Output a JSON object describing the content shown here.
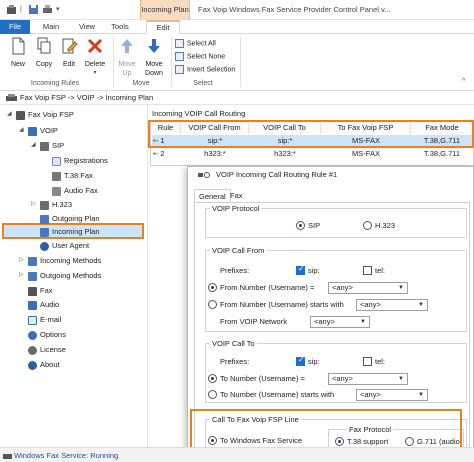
{
  "window": {
    "title": "Fax Voip Windows Fax Service Provider Control Panel v...",
    "context_tab_header": "Incoming Plan"
  },
  "tabs": [
    {
      "label": "File"
    },
    {
      "label": "Main"
    },
    {
      "label": "View"
    },
    {
      "label": "Tools"
    },
    {
      "label": "Edit"
    }
  ],
  "ribbon": {
    "new": "New",
    "copy": "Copy",
    "edit": "Edit",
    "delete": "Delete",
    "move_up": "Move Up",
    "move_down": "Move Down",
    "select_all": "Select All",
    "select_none": "Select None",
    "invert_selection": "Invert Selection",
    "groups": {
      "incoming_rules": "Incoming Rules",
      "move": "Move",
      "select": "Select"
    }
  },
  "breadcrumb": "Fax Voip FSP -> VOIP -> Incoming Plan",
  "tree": {
    "root": "Fax Voip FSP",
    "voip": "VOIP",
    "sip": "SIP",
    "registrations": "Registrations",
    "t38": "T.38 Fax",
    "audio_fax": "Audio Fax",
    "h323": "H.323",
    "outgoing_plan": "Outgoing Plan",
    "incoming_plan": "Incoming Plan",
    "user_agent": "User Agent",
    "incoming_methods": "Incoming Methods",
    "outgoing_methods": "Outgoing Methods",
    "fax": "Fax",
    "audio": "Audio",
    "email": "E-mail",
    "options": "Options",
    "license": "License",
    "about": "About"
  },
  "routing": {
    "title": "Incoming VOIP Call Routing",
    "columns": [
      "Rule",
      "VOIP Call From",
      "VOIP Call To",
      "To Fax Voip FSP",
      "Fax Mode"
    ],
    "rows": [
      {
        "rule": "1",
        "from": "sip:*",
        "to": "sip:*",
        "fsp": "MS-FAX",
        "mode": "T.38,G.711"
      },
      {
        "rule": "2",
        "from": "h323:*",
        "to": "h323:*",
        "fsp": "MS-FAX",
        "mode": "T.38,G.711"
      }
    ]
  },
  "dialog": {
    "title": "VOIP Incoming Call Routing Rule #1",
    "tabs": {
      "general": "General",
      "fax": "Fax"
    },
    "voip_protocol": {
      "title": "VOIP Protocol",
      "sip": "SIP",
      "h323": "H.323"
    },
    "call_from": {
      "title": "VOIP Call From",
      "prefixes": "Prefixes:",
      "sip": "sip:",
      "tel": "tel:",
      "from_number": "From Number (Username) =",
      "from_number_value": "<any>",
      "starts_with": "From Number (Username) starts with",
      "starts_with_value": "<any>",
      "network": "From VOIP Network",
      "network_value": "<any>"
    },
    "call_to": {
      "title": "VOIP Call To",
      "prefixes": "Prefixes:",
      "sip": "sip:",
      "tel": "tel:",
      "to_number": "To Number (Username) =",
      "to_number_value": "<any>",
      "starts_with": "To Number (Username) starts with",
      "starts_with_value": "<any>"
    },
    "fax_line": {
      "title": "Call To Fax Voip FSP Line",
      "windows_fax": "To Windows Fax Service",
      "protocol_title": "Fax Protocol",
      "t38": "T.38 support",
      "g711": "G.711 (audio)"
    }
  },
  "status": {
    "text": "Windows Fax Service: Running"
  },
  "colors": {
    "accent": "#1e6fc8",
    "highlight": "#e8821e",
    "selection": "#cde4f8"
  }
}
